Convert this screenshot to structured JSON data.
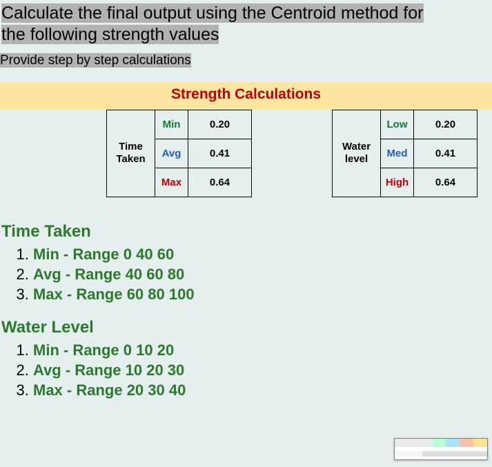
{
  "heading_line1": "Calculate the final output using the Centroid method for",
  "heading_line2": "the following strength values",
  "sub_heading": "Provide step by step calculations",
  "calc_title": "Strength Calculations",
  "table_left": {
    "row_label": "Time Taken",
    "rows": [
      {
        "label": "Min",
        "label_class": "c-green",
        "value": "0.20"
      },
      {
        "label": "Avg",
        "label_class": "c-blue",
        "value": "0.41"
      },
      {
        "label": "Max",
        "label_class": "c-red",
        "value": "0.64"
      }
    ]
  },
  "table_right": {
    "row_label": "Water level",
    "rows": [
      {
        "label": "Low",
        "label_class": "c-green",
        "value": "0.20"
      },
      {
        "label": "Med",
        "label_class": "c-blue",
        "value": "0.41"
      },
      {
        "label": "High",
        "label_class": "c-red",
        "value": "0.64"
      }
    ]
  },
  "ranges": {
    "time_taken": {
      "title": "Time Taken",
      "items": [
        "Min - Range 0 40 60",
        "Avg - Range 40 60 80",
        "Max - Range 60 80 100"
      ]
    },
    "water_level": {
      "title": "Water Level",
      "items": [
        "Min - Range 0 10 20",
        "Avg - Range 10 20 30",
        "Max - Range 20 30 40"
      ]
    }
  }
}
